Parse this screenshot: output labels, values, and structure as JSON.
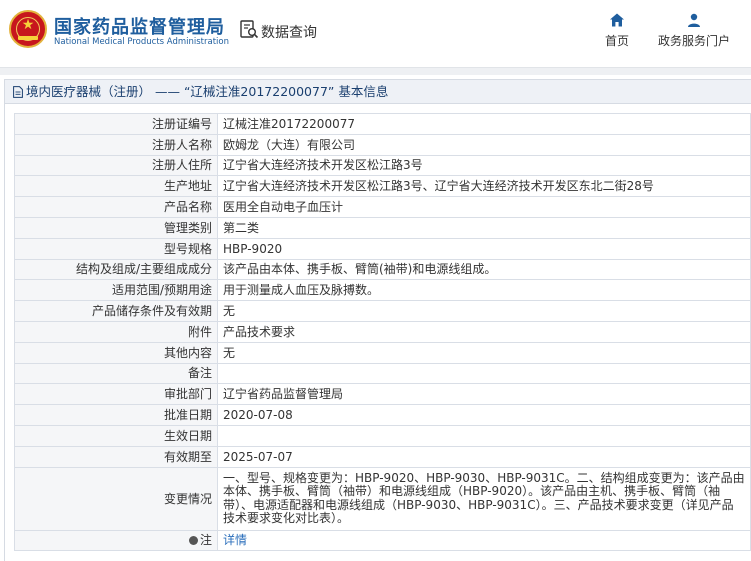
{
  "header": {
    "site_name": "国家药品监督管理局",
    "site_name_en": "National Medical Products Administration",
    "query_label": "数据查询",
    "nav": [
      {
        "label": "首页",
        "icon": "home-icon"
      },
      {
        "label": "政务服务门户",
        "icon": "user-icon"
      }
    ]
  },
  "panel": {
    "title": "境内医疗器械（注册） —— “辽械注准20172200077” 基本信息"
  },
  "rows": [
    {
      "label": "注册证编号",
      "value": "辽械注准20172200077"
    },
    {
      "label": "注册人名称",
      "value": "欧姆龙（大连）有限公司"
    },
    {
      "label": "注册人住所",
      "value": "辽宁省大连经济技术开发区松江路3号"
    },
    {
      "label": "生产地址",
      "value": "辽宁省大连经济技术开发区松江路3号、辽宁省大连经济技术开发区东北二街28号"
    },
    {
      "label": "产品名称",
      "value": "医用全自动电子血压计"
    },
    {
      "label": "管理类别",
      "value": "第二类"
    },
    {
      "label": "型号规格",
      "value": "HBP-9020"
    },
    {
      "label": "结构及组成/主要组成成分",
      "value": "该产品由本体、携手板、臂筒(袖带)和电源线组成。"
    },
    {
      "label": "适用范围/预期用途",
      "value": "用于测量成人血压及脉搏数。"
    },
    {
      "label": "产品储存条件及有效期",
      "value": "无"
    },
    {
      "label": "附件",
      "value": "产品技术要求"
    },
    {
      "label": "其他内容",
      "value": "无"
    },
    {
      "label": "备注",
      "value": ""
    },
    {
      "label": "审批部门",
      "value": "辽宁省药品监督管理局"
    },
    {
      "label": "批准日期",
      "value": "2020-07-08"
    },
    {
      "label": "生效日期",
      "value": ""
    },
    {
      "label": "有效期至",
      "value": "2025-07-07"
    },
    {
      "label": "变更情况",
      "value": "一、型号、规格变更为：HBP-9020、HBP-9030、HBP-9031C。二、结构组成变更为：该产品由本体、携手板、臂筒（袖带）和电源线组成（HBP-9020）。该产品由主机、携手板、臂筒（袖带）、电源适配器和电源线组成（HBP-9030、HBP-9031C）。三、产品技术要求变更（详见产品技术要求变化对比表）。"
    },
    {
      "label": "注",
      "value": "详情",
      "label_icon": "note-icon"
    }
  ]
}
